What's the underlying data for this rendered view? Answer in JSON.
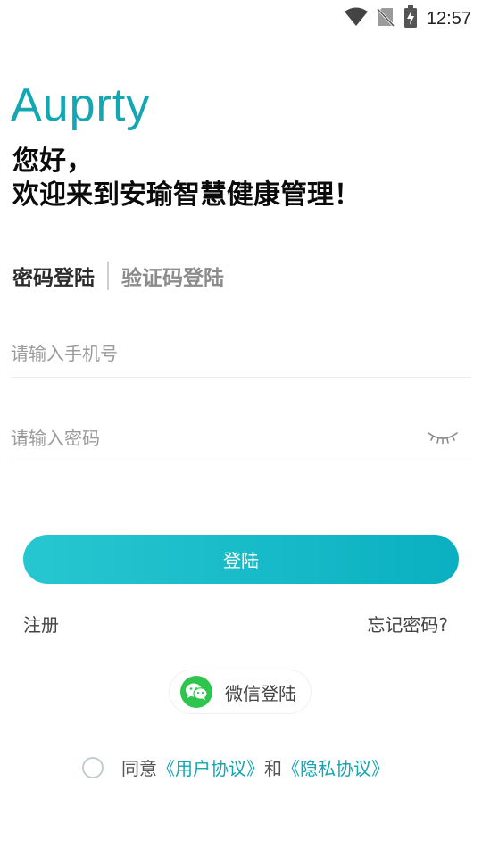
{
  "status": {
    "time": "12:57"
  },
  "brand": {
    "logo_text": "Auprty"
  },
  "greeting": {
    "line1": "您好，",
    "line2": "欢迎来到安瑜智慧健康管理！"
  },
  "tabs": {
    "password_login": "密码登陆",
    "code_login": "验证码登陆"
  },
  "form": {
    "phone_placeholder": "请输入手机号",
    "password_placeholder": "请输入密码",
    "login_button": "登陆"
  },
  "links": {
    "register": "注册",
    "forgot_password": "忘记密码?"
  },
  "wechat": {
    "label": "微信登陆"
  },
  "agreement": {
    "agree": "同意",
    "user_agreement": "《用户协议》",
    "and": "和",
    "privacy_policy": "《隐私协议》"
  },
  "colors": {
    "accent": "#13a6b3",
    "button_start": "#27c7d1",
    "button_end": "#0ab0c1",
    "wechat_green": "#2dc54d"
  }
}
